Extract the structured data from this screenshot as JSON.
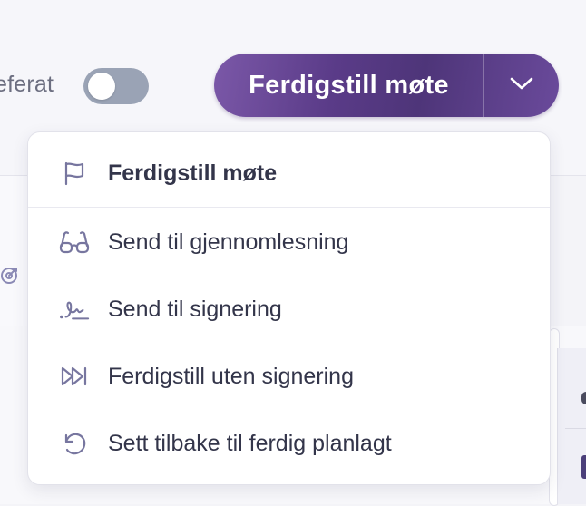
{
  "header": {
    "referat_label": "eferat",
    "referat_toggle_on": false
  },
  "split_button": {
    "label": "Ferdigstill møte",
    "toggle_icon": "chevron-down-icon"
  },
  "menu": {
    "items": [
      {
        "label": "Ferdigstill møte",
        "icon": "flag-icon",
        "primary": true
      },
      {
        "label": "Send til gjennomlesning",
        "icon": "glasses-icon",
        "primary": false
      },
      {
        "label": "Send til signering",
        "icon": "signature-icon",
        "primary": false
      },
      {
        "label": "Ferdigstill uten signering",
        "icon": "fast-forward-icon",
        "primary": false
      },
      {
        "label": "Sett tilbake til ferdig planlagt",
        "icon": "undo-icon",
        "primary": false
      }
    ]
  },
  "colors": {
    "button_primary": "#5a3b88",
    "icon": "#77769f",
    "toggle_off": "#9aa3b5"
  }
}
